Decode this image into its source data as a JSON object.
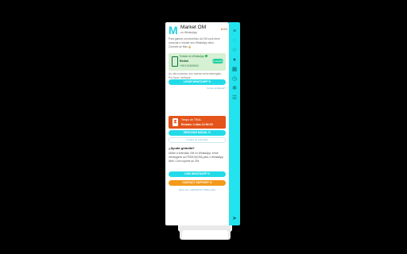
{
  "header": {
    "logo_letter": "M",
    "title": "Market OM",
    "subtitle": "on WhatsApp",
    "language": "EN"
  },
  "description": "Para ganhar um benefício do OM você deve conectar e manter seu WhatsApp ativo. Conecte-se Max 🔒",
  "status_card": {
    "line1": "Estado do WhatsApp",
    "line2": "Redmi",
    "line3": "+55 9.00000000",
    "badge": "Conectado"
  },
  "note": "Ao não conectar, seu acesso será restringido. Por favor, verifique.",
  "buttons": {
    "connect": "LIGAR WHATSAPP ↻",
    "renew": "RENOVAR MODAL ↻",
    "support": "LINK WHATSAPP ↻",
    "contact_support": "CONTACT SUPPORT ↻"
  },
  "links": {
    "after_connect": "Como configurar?",
    "after_support": "Quer ver o assistente? Clique aqui"
  },
  "timer_card": {
    "line1": "Tempo de TRIAL",
    "line2": "Restam: 4 dias 12:00:00"
  },
  "input_placeholder": "Código de indicação",
  "help": {
    "title": "¿Ayuda gratuita?",
    "text": "Utilize a extensão OM no WhatsApp: envie mensagens ao PEDIDO(OM) para o WhatsApp Web. Com suporte ao OM."
  },
  "rail_icons": [
    "menu-icon",
    "chat-icon",
    "star-icon",
    "user-icon",
    "grid-icon",
    "clock-icon",
    "settings-icon",
    "list-icon",
    "send-icon"
  ],
  "colors": {
    "accent": "#23dbe8",
    "warning": "#f39a1b",
    "timer": "#e4551b",
    "success_bg": "#d5f0d2"
  }
}
